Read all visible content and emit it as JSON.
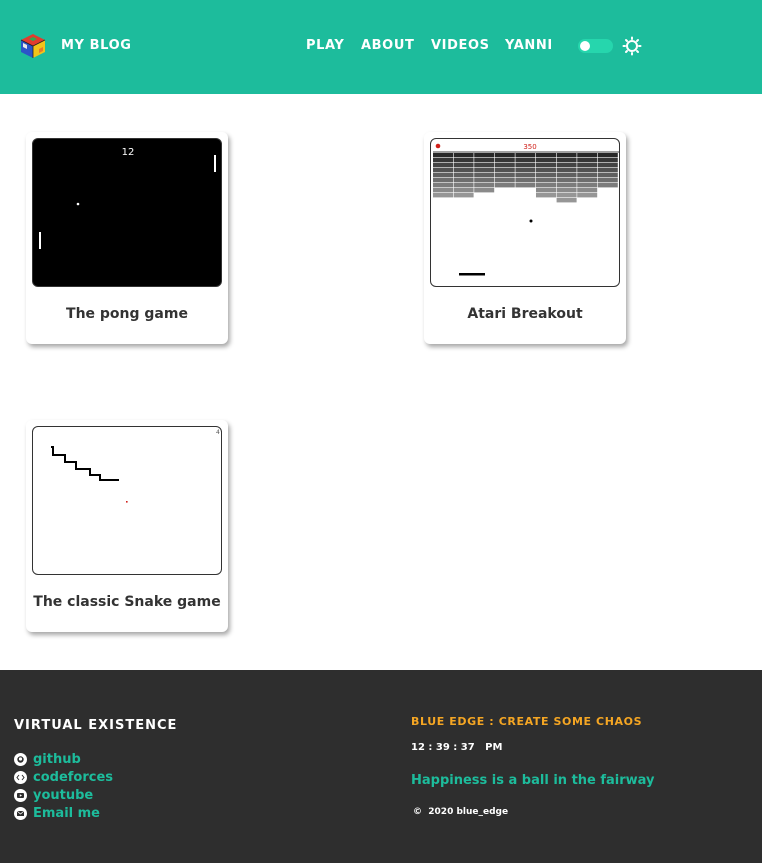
{
  "header": {
    "brand": "MY BLOG",
    "nav": [
      "PLAY",
      "ABOUT",
      "VIDEOS",
      "YANNI"
    ],
    "theme_toggle": {
      "on": true
    },
    "bg_color": "#1dbc9c"
  },
  "games": [
    {
      "title": "The pong game",
      "score": "12"
    },
    {
      "title": "Atari Breakout",
      "score": "350"
    },
    {
      "title": "The classic Snake game"
    }
  ],
  "footer": {
    "heading": "VIRTUAL EXISTENCE",
    "links": [
      {
        "label": "github",
        "icon": "github-icon"
      },
      {
        "label": "codeforces",
        "icon": "code-icon"
      },
      {
        "label": "youtube",
        "icon": "youtube-icon"
      },
      {
        "label": "Email me",
        "icon": "mail-icon"
      }
    ],
    "tagline": "BLUE EDGE : CREATE SOME CHAOS",
    "clock": "12 : 39 : 37   PM",
    "quote": "Happiness is a ball in the fairway",
    "copyright_symbol": "©",
    "copyright": "2020 blue_edge",
    "accent_color": "#f5a623",
    "link_color": "#1dbc9c"
  }
}
